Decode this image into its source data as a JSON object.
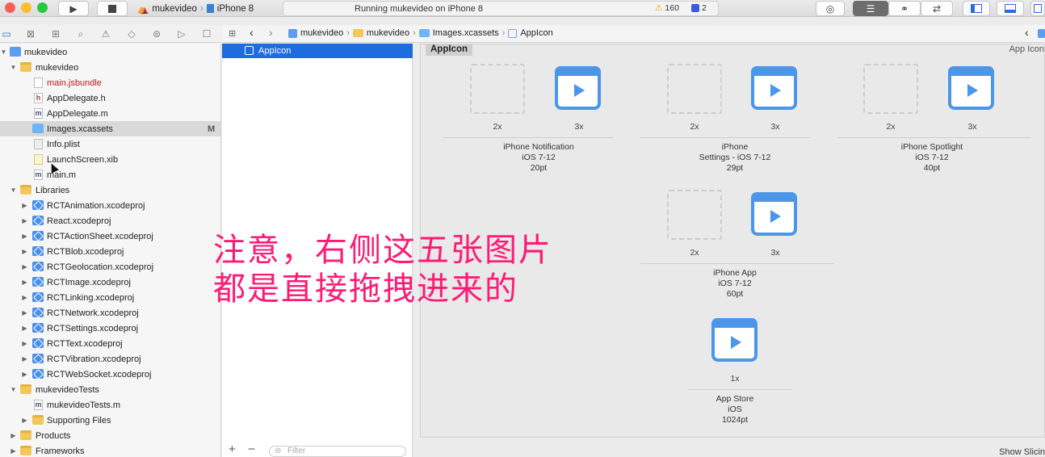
{
  "toolbar": {
    "scheme_target": "mukevideo",
    "device": "iPhone 8",
    "status": "Running mukevideo on iPhone 8",
    "warnings": "160",
    "issues": "2"
  },
  "jumpbar": {
    "crumbs": [
      "mukevideo",
      "mukevideo",
      "Images.xcassets",
      "AppIcon"
    ]
  },
  "navigator": {
    "items": [
      {
        "label": "mukevideo",
        "modified": ""
      },
      {
        "label": "mukevideo",
        "modified": ""
      },
      {
        "label": "main.jsbundle",
        "modified": ""
      },
      {
        "label": "AppDelegate.h",
        "modified": ""
      },
      {
        "label": "AppDelegate.m",
        "modified": ""
      },
      {
        "label": "Images.xcassets",
        "modified": "M"
      },
      {
        "label": "Info.plist",
        "modified": ""
      },
      {
        "label": "LaunchScreen.xib",
        "modified": ""
      },
      {
        "label": "main.m",
        "modified": ""
      },
      {
        "label": "Libraries",
        "modified": ""
      },
      {
        "label": "RCTAnimation.xcodeproj",
        "modified": ""
      },
      {
        "label": "React.xcodeproj",
        "modified": ""
      },
      {
        "label": "RCTActionSheet.xcodeproj",
        "modified": ""
      },
      {
        "label": "RCTBlob.xcodeproj",
        "modified": ""
      },
      {
        "label": "RCTGeolocation.xcodeproj",
        "modified": ""
      },
      {
        "label": "RCTImage.xcodeproj",
        "modified": ""
      },
      {
        "label": "RCTLinking.xcodeproj",
        "modified": ""
      },
      {
        "label": "RCTNetwork.xcodeproj",
        "modified": ""
      },
      {
        "label": "RCTSettings.xcodeproj",
        "modified": ""
      },
      {
        "label": "RCTText.xcodeproj",
        "modified": ""
      },
      {
        "label": "RCTVibration.xcodeproj",
        "modified": ""
      },
      {
        "label": "RCTWebSocket.xcodeproj",
        "modified": ""
      },
      {
        "label": "mukevideoTests",
        "modified": ""
      },
      {
        "label": "mukevideoTests.m",
        "modified": ""
      },
      {
        "label": "Supporting Files",
        "modified": ""
      },
      {
        "label": "Products",
        "modified": ""
      },
      {
        "label": "Frameworks",
        "modified": ""
      }
    ]
  },
  "asset_list": {
    "selected": "AppIcon",
    "filter_placeholder": "Filter"
  },
  "editor": {
    "set_name": "AppIcon",
    "set_name_right": "App Icon",
    "groups": [
      {
        "title": "iPhone Notification",
        "os": "iOS 7-12",
        "size": "20pt",
        "scale_a": "2x",
        "scale_b": "3x"
      },
      {
        "title": "iPhone",
        "os": "Settings - iOS 7-12",
        "size": "29pt",
        "scale_a": "2x",
        "scale_b": "3x"
      },
      {
        "title": "iPhone Spotlight",
        "os": "iOS 7-12",
        "size": "40pt",
        "scale_a": "2x",
        "scale_b": "3x"
      },
      {
        "title": "iPhone App",
        "os": "iOS 7-12",
        "size": "60pt",
        "scale_a": "2x",
        "scale_b": "3x"
      },
      {
        "title": "App Store",
        "os": "iOS",
        "size": "1024pt",
        "scale_a": "1x"
      }
    ],
    "show_slicing": "Show Slicin"
  },
  "overlay": {
    "line1": "注意，右侧这五张图片",
    "line2": "都是直接拖拽进来的"
  },
  "colors": {
    "selection_blue": "#1d6ce0",
    "icon_blue": "#4c96ea",
    "overlay_pink": "#ff1a75"
  }
}
